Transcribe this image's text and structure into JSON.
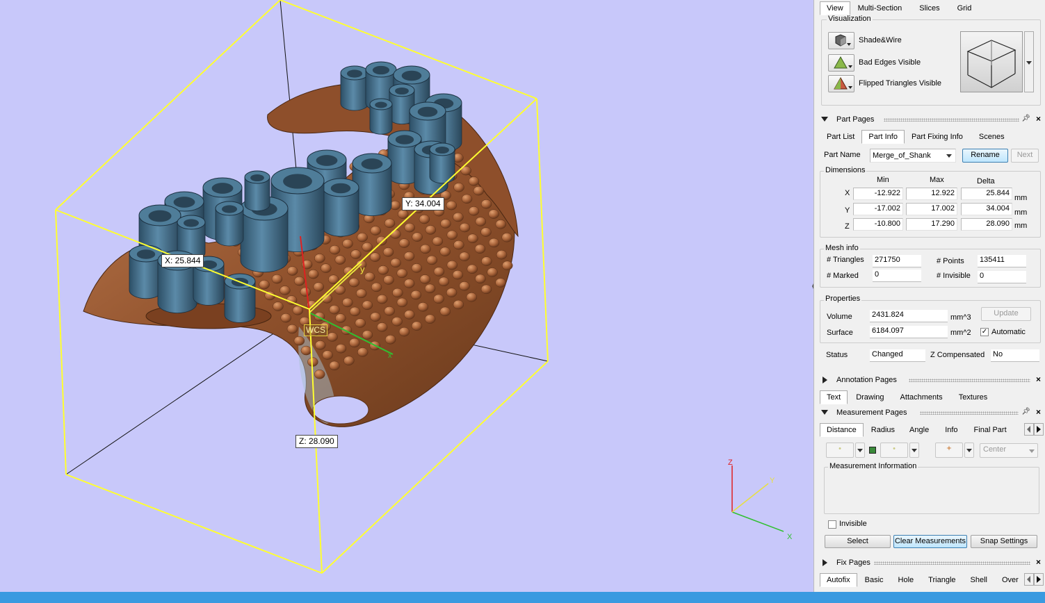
{
  "viewport": {
    "labels": {
      "x": "X: 25.844",
      "y": "Y: 34.004",
      "z": "Z: 28.090",
      "wcs": "WCS"
    },
    "triad": {
      "x": "X",
      "y": "Y",
      "z": "Z"
    },
    "colors": {
      "background": "#c8c8fa",
      "bbox": "#ffff00",
      "part": "#9a5a33",
      "supports": "#3e6a87"
    }
  },
  "panel": {
    "view_tabs": [
      "View",
      "Multi-Section",
      "Slices",
      "Grid"
    ],
    "visualization": {
      "title": "Visualization",
      "items": [
        "Shade&Wire",
        "Bad Edges Visible",
        "Flipped Triangles Visible"
      ]
    },
    "part_pages": {
      "title": "Part Pages",
      "tabs": [
        "Part List",
        "Part Info",
        "Part Fixing Info",
        "Scenes"
      ],
      "part_name_label": "Part Name",
      "part_name_value": "Merge_of_Shank",
      "rename": "Rename",
      "next": "Next",
      "dimensions": {
        "title": "Dimensions",
        "headers": [
          "Min",
          "Max",
          "Delta"
        ],
        "rows": [
          {
            "axis": "X",
            "min": "-12.922",
            "max": "12.922",
            "delta": "25.844",
            "unit": "mm"
          },
          {
            "axis": "Y",
            "min": "-17.002",
            "max": "17.002",
            "delta": "34.004",
            "unit": "mm"
          },
          {
            "axis": "Z",
            "min": "-10.800",
            "max": "17.290",
            "delta": "28.090",
            "unit": "mm"
          }
        ]
      },
      "mesh_info": {
        "title": "Mesh info",
        "triangles_label": "# Triangles",
        "triangles": "271750",
        "points_label": "# Points",
        "points": "135411",
        "marked_label": "# Marked",
        "marked": "0",
        "invisible_label": "# Invisible",
        "invisible": "0"
      },
      "properties": {
        "title": "Properties",
        "volume_label": "Volume",
        "volume": "2431.824",
        "volume_unit": "mm^3",
        "surface_label": "Surface",
        "surface": "6184.097",
        "surface_unit": "mm^2",
        "update": "Update",
        "automatic": "Automatic"
      },
      "status_label": "Status",
      "status": "Changed",
      "zcomp_label": "Z Compensated",
      "zcomp": "No"
    },
    "annotation_pages": {
      "title": "Annotation Pages",
      "tabs": [
        "Text",
        "Drawing",
        "Attachments",
        "Textures"
      ]
    },
    "measurement_pages": {
      "title": "Measurement Pages",
      "tabs": [
        "Distance",
        "Radius",
        "Angle",
        "Info",
        "Final Part"
      ],
      "center": "Center",
      "info_title": "Measurement Information",
      "invisible": "Invisible",
      "select": "Select",
      "clear": "Clear Measurements",
      "snap": "Snap Settings"
    },
    "fix_pages": {
      "title": "Fix Pages",
      "tabs": [
        "Autofix",
        "Basic",
        "Hole",
        "Triangle",
        "Shell",
        "Over"
      ]
    }
  }
}
